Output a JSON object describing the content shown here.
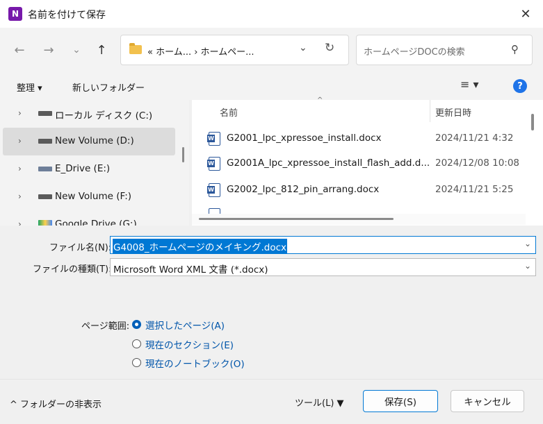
{
  "window": {
    "title": "名前を付けて保存",
    "app_icon": "N",
    "close": "✕"
  },
  "nav": {
    "back": "←",
    "forward": "→",
    "recent": "⌄",
    "up": "↑",
    "address": "«  ホーム...  ›  ホームペー...",
    "refresh": "↻",
    "search_placeholder": "ホームページDOCの検索"
  },
  "toolbar": {
    "organize": "整理 ▾",
    "new_folder": "新しいフォルダー",
    "view": "≡ ▾",
    "help": "?"
  },
  "sidebar": {
    "items": [
      {
        "label": "ローカル ディスク (C:)",
        "icon": "drive-icon"
      },
      {
        "label": "New Volume (D:)",
        "icon": "drive-icon",
        "selected": true
      },
      {
        "label": "E_Drive (E:)",
        "icon": "network-drive-icon"
      },
      {
        "label": "New Volume (F:)",
        "icon": "drive-icon"
      },
      {
        "label": "Google Drive (G:)",
        "icon": "google-drive-icon"
      }
    ]
  },
  "files": {
    "columns": {
      "name": "名前",
      "date": "更新日時"
    },
    "rows": [
      {
        "name": "G2001_lpc_xpressoe_install.docx",
        "date": "2024/11/21 4:32"
      },
      {
        "name": "G2001A_lpc_xpressoe_install_flash_add.d...",
        "date": "2024/12/08 10:08"
      },
      {
        "name": "G2002_lpc_812_pin_arrang.docx",
        "date": "2024/11/21 5:25"
      }
    ]
  },
  "form": {
    "filename_label": "ファイル名(N):",
    "filename_value": "G4008_ホームページのメイキング.docx",
    "filetype_label": "ファイルの種類(T):",
    "filetype_value": "Microsoft Word XML 文書 (*.docx)",
    "page_range_label": "ページ範囲:",
    "radios": [
      {
        "label": "選択したページ(A)",
        "checked": true
      },
      {
        "label": "現在のセクション(E)",
        "checked": false
      },
      {
        "label": "現在のノートブック(O)",
        "checked": false
      }
    ]
  },
  "footer": {
    "hide_folders": "^  フォルダーの非表示",
    "tools": "ツール(L)   ▼",
    "save": "保存(S)",
    "cancel": "キャンセル"
  },
  "colors": {
    "accent": "#0078d4",
    "onenote": "#7719aa",
    "word": "#2b579a"
  }
}
